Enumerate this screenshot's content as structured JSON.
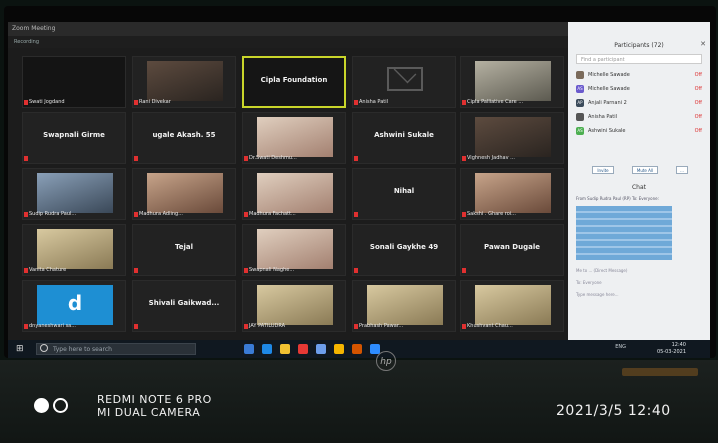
{
  "zoom": {
    "window_title": "Zoom Meeting",
    "subbar_text": "Recording"
  },
  "gallery": [
    {
      "name": "Swati Jogdand",
      "video": "dark"
    },
    {
      "name": "Rani Divekar",
      "video": "vid-a"
    },
    {
      "name": "Cipla Foundation",
      "center": true,
      "active": true
    },
    {
      "name": "Anisha Patil",
      "video": "envelope"
    },
    {
      "name": "Cipla Palliative Care ...",
      "video": "vid-e"
    },
    {
      "name": "Swapnali Girme",
      "center": true
    },
    {
      "name": "ugale Akash. 55",
      "center": true
    },
    {
      "name": "Dr.Swati Deshmu...",
      "video": "vid-c"
    },
    {
      "name": "Ashwini Sukale",
      "center": true
    },
    {
      "name": "Vighnesh Jadhav ...",
      "video": "vid-a"
    },
    {
      "name": "Sudip Rudra Paul...",
      "video": "vid-d"
    },
    {
      "name": "Madhura Adling...",
      "video": "vid-b"
    },
    {
      "name": "Madhura Fachatt...",
      "video": "vid-c"
    },
    {
      "name": "Nihal",
      "center": true
    },
    {
      "name": "Sakshi . Ghare roi...",
      "video": "vid-b"
    },
    {
      "name": "Vanita Chature",
      "video": "vid-f"
    },
    {
      "name": "Tejal",
      "center": true
    },
    {
      "name": "Swapnali Naghe...",
      "video": "vid-c"
    },
    {
      "name": "Sonali Gaykhe 49",
      "center": true
    },
    {
      "name": "Pawan Dugale",
      "center": true
    },
    {
      "name": "dnyaneshwari sa...",
      "video": "vid-g"
    },
    {
      "name": "Shivali Gaikwad...",
      "center": true
    },
    {
      "name": "JAY PATILUDRA",
      "video": "vid-f"
    },
    {
      "name": "Prabhash Pawar...",
      "video": "vid-f"
    },
    {
      "name": "Khushvant Chau...",
      "video": "vid-f"
    }
  ],
  "participants_panel": {
    "title": "Participants (72)",
    "search_placeholder": "Find a participant",
    "rows": [
      {
        "initials": "",
        "name": "Michelle Sawade",
        "color": "#7a6a5a"
      },
      {
        "initials": "AS",
        "name": "Michelle Sawade",
        "color": "#6a5acd"
      },
      {
        "initials": "AP",
        "name": "Anjali Parnani 2",
        "color": "#3a4a5a"
      },
      {
        "initials": "",
        "name": "Anisha Patil",
        "color": "#555555"
      },
      {
        "initials": "AS",
        "name": "Ashwini Sukale",
        "color": "#4caf50"
      }
    ],
    "row_status": "Off",
    "btn_invite": "Invite",
    "btn_mute_all": "Mute All",
    "btn_more": "...",
    "chat_title": "Chat",
    "chat_from": "From Sudip Rudra Paul (RP) To: Everyone:",
    "chat_line_1": "Me to ... (Direct Message)",
    "chat_line_2": "To: Everyone",
    "chat_line_3": "Type message here..."
  },
  "taskbar": {
    "search_placeholder": "Type here to search",
    "time": "12:40",
    "date": "05-03-2021",
    "tray_text": "ENG"
  },
  "laptop": {
    "logo": "hp"
  },
  "watermark": {
    "line1": "REDMI NOTE 6 PRO",
    "line2": "MI DUAL CAMERA",
    "datetime": "2021/3/5  12:40"
  }
}
